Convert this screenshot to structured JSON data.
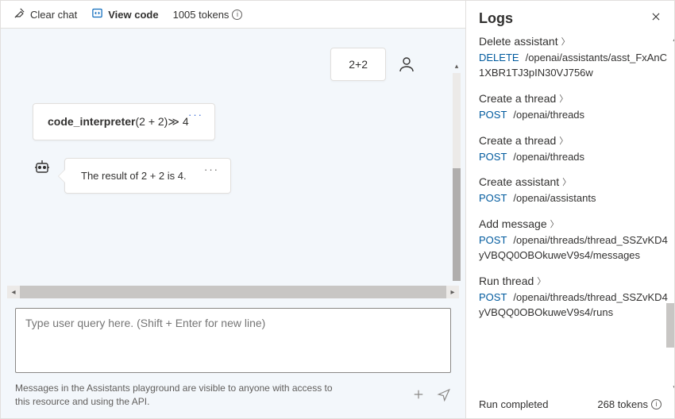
{
  "toolbar": {
    "clear_chat": "Clear chat",
    "view_code": "View code",
    "tokens": "1005 tokens"
  },
  "chat": {
    "user_message": "2+2",
    "tool_call": {
      "name": "code_interpreter",
      "args": "(2 + 2)",
      "result_sep": "≫",
      "result": "4"
    },
    "assistant_message": "The result of 2 + 2 is 4.",
    "input_placeholder": "Type user query here. (Shift + Enter for new line)",
    "disclaimer": "Messages in the Assistants playground are visible to anyone with access to this resource and using the API."
  },
  "logs": {
    "title": "Logs",
    "entries": [
      {
        "title": "Delete assistant",
        "method": "DELETE",
        "path": "/openai/assistants/asst_FxAnC1XBR1TJ3pIN30VJ756w"
      },
      {
        "title": "Create a thread",
        "method": "POST",
        "path": "/openai/threads"
      },
      {
        "title": "Create a thread",
        "method": "POST",
        "path": "/openai/threads"
      },
      {
        "title": "Create assistant",
        "method": "POST",
        "path": "/openai/assistants"
      },
      {
        "title": "Add message",
        "method": "POST",
        "path": "/openai/threads/thread_SSZvKD4yVBQQ0OBOkuweV9s4/messages"
      },
      {
        "title": "Run thread",
        "method": "POST",
        "path": "/openai/threads/thread_SSZvKD4yVBQQ0OBOkuweV9s4/runs"
      }
    ],
    "footer_status": "Run completed",
    "footer_tokens": "268 tokens"
  }
}
